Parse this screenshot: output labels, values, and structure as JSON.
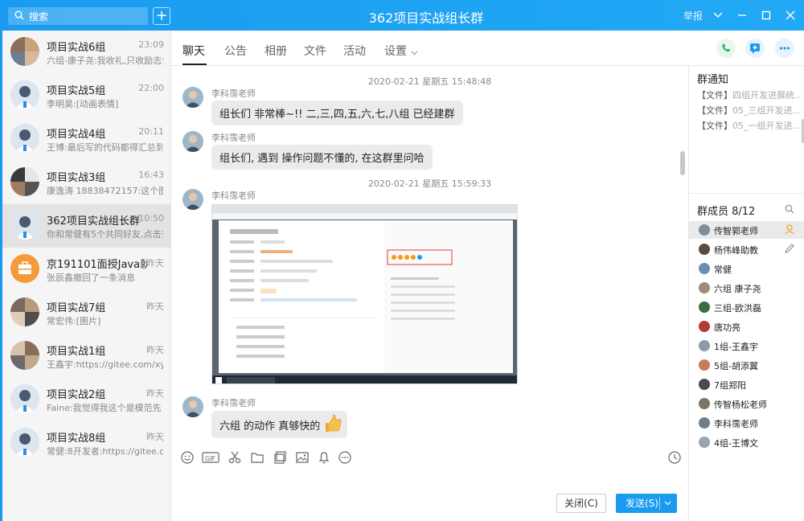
{
  "window": {
    "title": "362项目实战组长群",
    "report": "举报"
  },
  "search": {
    "placeholder": "搜索"
  },
  "chats": [
    {
      "name": "项目实战6组",
      "time": "23:09",
      "preview": "六组-康子尧:我收礼,只收励志金"
    },
    {
      "name": "项目实战5组",
      "time": "22:00",
      "preview": "李明昊:[动画表情]"
    },
    {
      "name": "项目实战4组",
      "time": "20:11",
      "preview": "王博:最后写的代码都得汇总到一"
    },
    {
      "name": "项目实战3组",
      "time": "16:43",
      "preview": "康逸涛 18838472157:这个图标"
    },
    {
      "name": "362项目实战组长群",
      "time": "10:50",
      "preview": "你和常健有5个共同好友,点击查看"
    },
    {
      "name": "京191101面授Java就业班",
      "time": "昨天",
      "preview": "张辰鑫撤回了一条消息"
    },
    {
      "name": "项目实战7组",
      "time": "昨天",
      "preview": "常宏伟:[图片]"
    },
    {
      "name": "项目实战1组",
      "time": "昨天",
      "preview": "王鑫宇:https://gitee.com/xyang"
    },
    {
      "name": "项目实战2组",
      "time": "昨天",
      "preview": "Faine:我觉得我这个是模范先"
    },
    {
      "name": "项目实战8组",
      "time": "昨天",
      "preview": "常健:8开发者:https://gitee.com"
    }
  ],
  "tabs": [
    "聊天",
    "公告",
    "相册",
    "文件",
    "活动",
    "设置"
  ],
  "messages": {
    "ts1": "2020-02-21 星期五 15:48:48",
    "ts2": "2020-02-21 星期五 15:59:33",
    "sender": "李科霈老师",
    "m1": "组长们 非常棒~!! 二,三,四,五,六,七,八组 已经建群",
    "m2": "组长们, 遇到 操作问题不懂的, 在这群里问哈",
    "m4": "六组 的动作 真够快的"
  },
  "composer": {
    "close": "关闭(C)",
    "send": "发送(S)"
  },
  "right": {
    "notice_title": "群通知",
    "notices": [
      {
        "tag": "【文件】",
        "text": "四组开发进展统…"
      },
      {
        "tag": "【文件】",
        "text": "05_三组开发进…"
      },
      {
        "tag": "【文件】",
        "text": "05_一组开发进…"
      }
    ],
    "members_title": "群成员 8/12",
    "members": [
      "传智郭老师",
      "杨伟峰助教",
      "常健",
      "六组 康子尧",
      "三组-欧洪磊",
      "唐功亮",
      "1组-王鑫宇",
      "5组-胡添翼",
      "7组郑阳",
      "传智杨松老师",
      "李科霈老师",
      "4组-王博文"
    ]
  },
  "colors": {
    "accent": "#1a9bf0"
  }
}
